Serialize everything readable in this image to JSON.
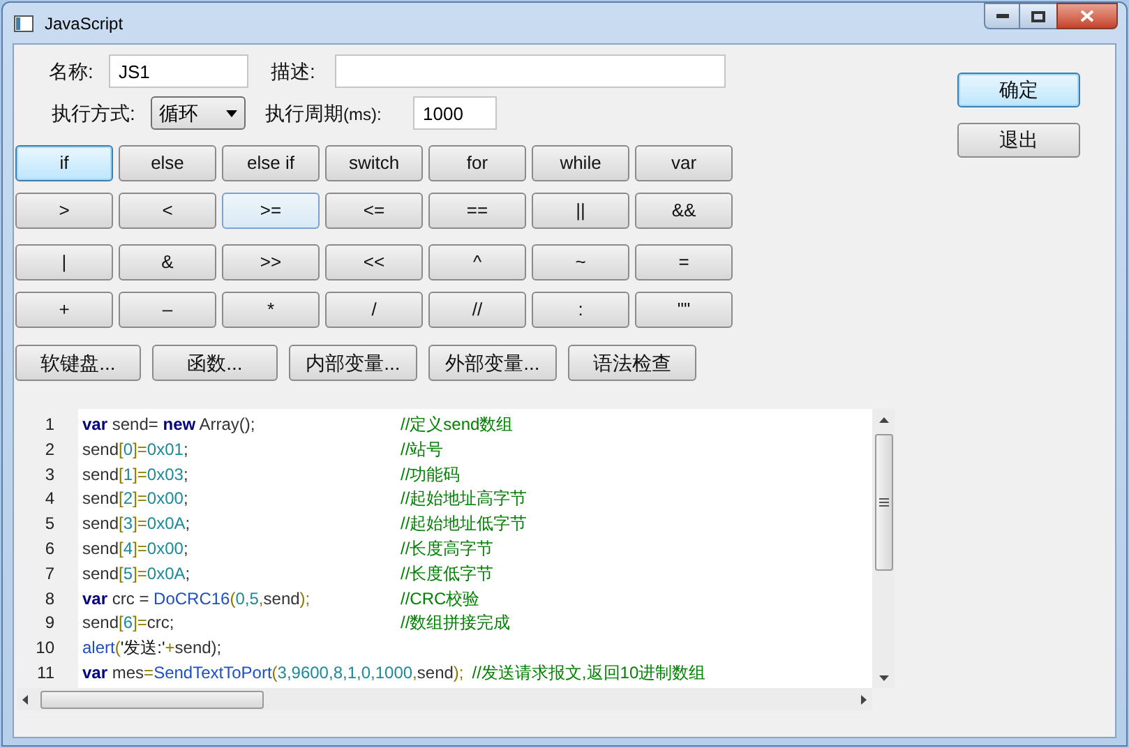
{
  "window": {
    "title": "JavaScript"
  },
  "form": {
    "name_label": "名称:",
    "name_value": "JS1",
    "desc_label": "描述:",
    "mode_label": "执行方式:",
    "mode_value": "循环",
    "period_label": "执行周期",
    "period_unit": "(ms):",
    "period_value": "1000"
  },
  "side_buttons": [
    {
      "label": "确定",
      "focused": true
    },
    {
      "label": "退出",
      "focused": false
    }
  ],
  "keypad": [
    [
      {
        "label": "if",
        "focused": true,
        "hovered": false
      },
      {
        "label": "else",
        "focused": false,
        "hovered": false
      },
      {
        "label": "else if",
        "focused": false,
        "hovered": false
      },
      {
        "label": "switch",
        "focused": false,
        "hovered": false
      },
      {
        "label": "for",
        "focused": false,
        "hovered": false
      },
      {
        "label": "while",
        "focused": false,
        "hovered": false
      },
      {
        "label": "var",
        "focused": false,
        "hovered": false
      }
    ],
    [
      {
        "label": ">",
        "focused": false,
        "hovered": false
      },
      {
        "label": "<",
        "focused": false,
        "hovered": false
      },
      {
        "label": ">=",
        "focused": false,
        "hovered": true
      },
      {
        "label": "<=",
        "focused": false,
        "hovered": false
      },
      {
        "label": "==",
        "focused": false,
        "hovered": false
      },
      {
        "label": "||",
        "focused": false,
        "hovered": false
      },
      {
        "label": "&&",
        "focused": false,
        "hovered": false
      }
    ],
    [
      {
        "label": "|",
        "focused": false,
        "hovered": false
      },
      {
        "label": "&",
        "focused": false,
        "hovered": false
      },
      {
        "label": ">>",
        "focused": false,
        "hovered": false
      },
      {
        "label": "<<",
        "focused": false,
        "hovered": false
      },
      {
        "label": "^",
        "focused": false,
        "hovered": false
      },
      {
        "label": "~",
        "focused": false,
        "hovered": false
      },
      {
        "label": "=",
        "focused": false,
        "hovered": false
      }
    ],
    [
      {
        "label": "+",
        "focused": false,
        "hovered": false
      },
      {
        "label": "–",
        "focused": false,
        "hovered": false
      },
      {
        "label": "*",
        "focused": false,
        "hovered": false
      },
      {
        "label": "/",
        "focused": false,
        "hovered": false
      },
      {
        "label": "//",
        "focused": false,
        "hovered": false
      },
      {
        "label": ":",
        "focused": false,
        "hovered": false
      },
      {
        "label": "\"\"",
        "focused": false,
        "hovered": false
      }
    ]
  ],
  "tool_buttons": [
    "软键盘...",
    "函数...",
    "内部变量...",
    "外部变量...",
    "语法检查"
  ],
  "editor": {
    "lines": [
      {
        "number": "1",
        "tokens": [
          {
            "kind": "keyword",
            "text": "var"
          },
          {
            "kind": "plain",
            "text": " send= "
          },
          {
            "kind": "keyword",
            "text": "new"
          },
          {
            "kind": "plain",
            "text": " Array();"
          }
        ],
        "comment": "//定义send数组"
      },
      {
        "number": "2",
        "tokens": [
          {
            "kind": "plain",
            "text": "send"
          },
          {
            "kind": "operator",
            "text": "["
          },
          {
            "kind": "number",
            "text": "0"
          },
          {
            "kind": "operator",
            "text": "]="
          },
          {
            "kind": "number",
            "text": "0x01"
          },
          {
            "kind": "plain",
            "text": ";"
          }
        ],
        "comment": "//站号"
      },
      {
        "number": "3",
        "tokens": [
          {
            "kind": "plain",
            "text": "send"
          },
          {
            "kind": "operator",
            "text": "["
          },
          {
            "kind": "number",
            "text": "1"
          },
          {
            "kind": "operator",
            "text": "]="
          },
          {
            "kind": "number",
            "text": "0x03"
          },
          {
            "kind": "plain",
            "text": ";"
          }
        ],
        "comment": "//功能码"
      },
      {
        "number": "4",
        "tokens": [
          {
            "kind": "plain",
            "text": "send"
          },
          {
            "kind": "operator",
            "text": "["
          },
          {
            "kind": "number",
            "text": "2"
          },
          {
            "kind": "operator",
            "text": "]="
          },
          {
            "kind": "number",
            "text": "0x00"
          },
          {
            "kind": "plain",
            "text": ";"
          }
        ],
        "comment": "//起始地址高字节"
      },
      {
        "number": "5",
        "tokens": [
          {
            "kind": "plain",
            "text": "send"
          },
          {
            "kind": "operator",
            "text": "["
          },
          {
            "kind": "number",
            "text": "3"
          },
          {
            "kind": "operator",
            "text": "]="
          },
          {
            "kind": "number",
            "text": "0x0A"
          },
          {
            "kind": "plain",
            "text": ";"
          }
        ],
        "comment": "//起始地址低字节"
      },
      {
        "number": "6",
        "tokens": [
          {
            "kind": "plain",
            "text": "send"
          },
          {
            "kind": "operator",
            "text": "["
          },
          {
            "kind": "number",
            "text": "4"
          },
          {
            "kind": "operator",
            "text": "]="
          },
          {
            "kind": "number",
            "text": "0x00"
          },
          {
            "kind": "plain",
            "text": ";"
          }
        ],
        "comment": "//长度高字节"
      },
      {
        "number": "7",
        "tokens": [
          {
            "kind": "plain",
            "text": "send"
          },
          {
            "kind": "operator",
            "text": "["
          },
          {
            "kind": "number",
            "text": "5"
          },
          {
            "kind": "operator",
            "text": "]="
          },
          {
            "kind": "number",
            "text": "0x0A"
          },
          {
            "kind": "plain",
            "text": ";"
          }
        ],
        "comment": "//长度低字节"
      },
      {
        "number": "8",
        "tokens": [
          {
            "kind": "keyword",
            "text": "var"
          },
          {
            "kind": "plain",
            "text": " crc = "
          },
          {
            "kind": "function",
            "text": "DoCRC16"
          },
          {
            "kind": "operator",
            "text": "("
          },
          {
            "kind": "number",
            "text": "0,5"
          },
          {
            "kind": "operator",
            "text": ","
          },
          {
            "kind": "plain",
            "text": "send"
          },
          {
            "kind": "operator",
            "text": ");"
          }
        ],
        "comment": "//CRC校验"
      },
      {
        "number": "9",
        "tokens": [
          {
            "kind": "plain",
            "text": "send"
          },
          {
            "kind": "operator",
            "text": "["
          },
          {
            "kind": "number",
            "text": "6"
          },
          {
            "kind": "operator",
            "text": "]="
          },
          {
            "kind": "plain",
            "text": "crc;"
          }
        ],
        "comment": "//数组拼接完成"
      },
      {
        "number": "10",
        "tokens": [
          {
            "kind": "function",
            "text": "alert"
          },
          {
            "kind": "operator",
            "text": "("
          },
          {
            "kind": "string",
            "text": "'发送:'"
          },
          {
            "kind": "operator",
            "text": "+"
          },
          {
            "kind": "plain",
            "text": "send);"
          }
        ]
      },
      {
        "number": "11",
        "tokens": [
          {
            "kind": "keyword",
            "text": "var"
          },
          {
            "kind": "plain",
            "text": " mes"
          },
          {
            "kind": "operator",
            "text": "="
          },
          {
            "kind": "function",
            "text": "SendTextToPort"
          },
          {
            "kind": "operator",
            "text": "("
          },
          {
            "kind": "number",
            "text": "3,9600,8,1,0,1000"
          },
          {
            "kind": "operator",
            "text": ","
          },
          {
            "kind": "plain",
            "text": "send"
          },
          {
            "kind": "operator",
            "text": ");"
          }
        ],
        "comment": "//发送请求报文,返回10进制数组"
      }
    ]
  }
}
